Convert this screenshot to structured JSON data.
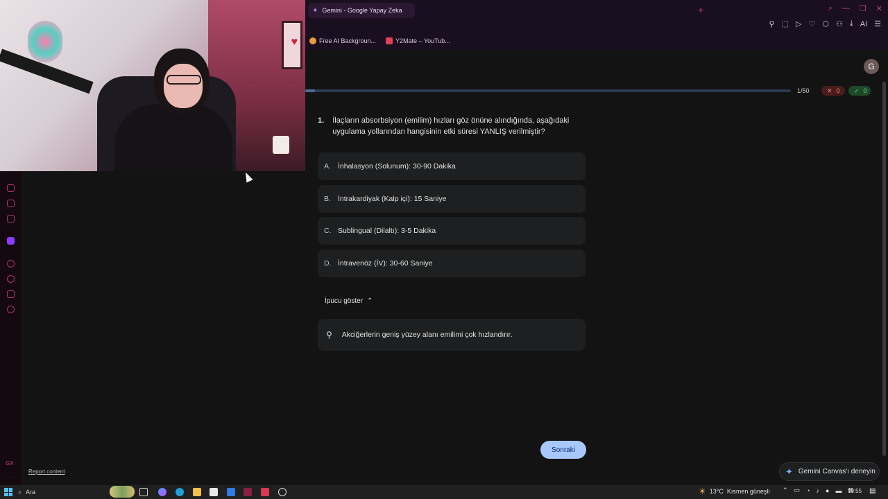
{
  "browser": {
    "tab_title": "Gemini - Google Yapay Zeka",
    "new_tab": "+",
    "bookmarks": [
      {
        "label": "Free AI Backgroun..."
      },
      {
        "label": "Y2Mate – YouTub..."
      }
    ],
    "toolbar_ai": "AI"
  },
  "quiz": {
    "avatar_letter": "G",
    "progress_text": "1/50",
    "progress_fraction": 0.02,
    "wrong_count": "0",
    "correct_count": "0",
    "question_number": "1.",
    "question_text": "İlaçların absorbsiyon (emilim) hızları göz önüne alındığında, aşağıdaki uygulama yollarından hangisinin etki süresi YANLIŞ verilmiştir?",
    "options": [
      {
        "letter": "A.",
        "text": "İnhalasyon (Solunum): 30-90 Dakika"
      },
      {
        "letter": "B.",
        "text": "İntrakardiyak (Kalp içi): 15 Saniye"
      },
      {
        "letter": "C.",
        "text": "Sublingual (Dilaltı): 3-5 Dakika"
      },
      {
        "letter": "D.",
        "text": "İntravenöz (İV): 30-60 Saniye"
      }
    ],
    "hint_toggle": "İpucu göster",
    "hint_text": "Akciğerlerin geniş yüzey alanı emilimi çok hızlandırır.",
    "next_button": "Sonraki",
    "canvas_prompt": "Gemini Canvas'ı deneyin"
  },
  "page": {
    "report_link": "Report content",
    "sidebar_gx": "GX"
  },
  "taskbar": {
    "search_label": "Ara",
    "weather_temp": "13°C",
    "weather_desc": "Kısmen güneşli",
    "time": "19:55"
  },
  "colors": {
    "accent": "#a8c7fa",
    "browser_accent": "#e23a7b",
    "wrong": "#f28b82",
    "correct": "#81c995"
  }
}
